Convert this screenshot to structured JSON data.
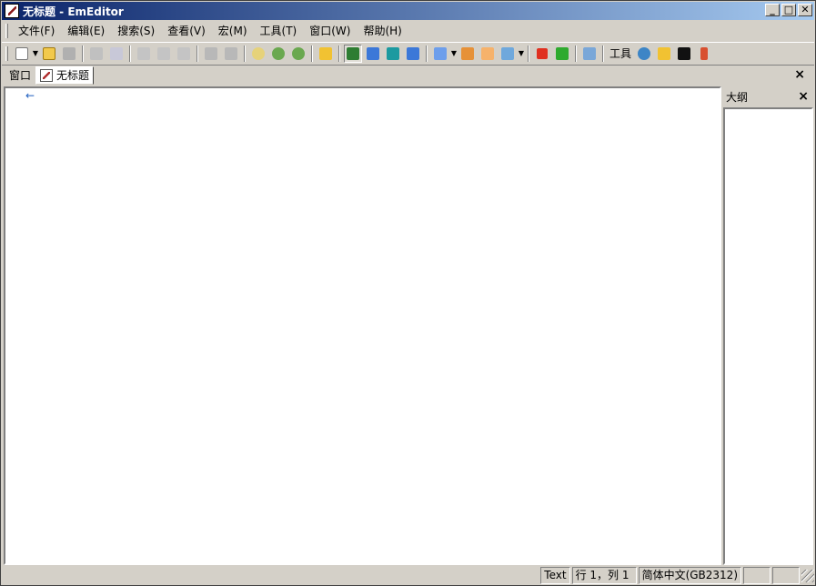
{
  "window": {
    "title": "无标题 - EmEditor",
    "controls": {
      "minimize": "_",
      "maximize": "□",
      "close": "✕"
    }
  },
  "menubar": {
    "items": [
      {
        "label": "文件(F)"
      },
      {
        "label": "编辑(E)"
      },
      {
        "label": "搜索(S)"
      },
      {
        "label": "查看(V)"
      },
      {
        "label": "宏(M)"
      },
      {
        "label": "工具(T)"
      },
      {
        "label": "窗口(W)"
      },
      {
        "label": "帮助(H)"
      }
    ]
  },
  "toolbar": {
    "tools_label": "工具"
  },
  "tabbar": {
    "window_label": "窗口",
    "doc_tab_label": "无标题",
    "close": "×"
  },
  "editor": {
    "line_marker": "←"
  },
  "outline": {
    "title": "大纲",
    "close": "×"
  },
  "statusbar": {
    "mode": "Text",
    "position": "行 1，列 1",
    "encoding": "简体中文(GB2312)"
  },
  "colors": {
    "titlebar_start": "#0a246a",
    "titlebar_end": "#a6caf0",
    "chrome": "#d4d0c8"
  }
}
